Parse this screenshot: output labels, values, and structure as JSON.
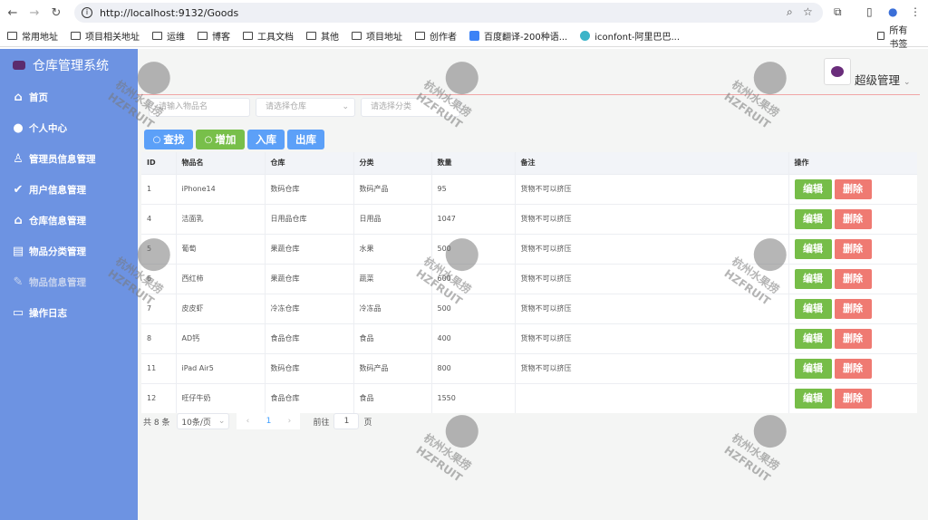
{
  "browser": {
    "url": "http://localhost:9132/Goods",
    "bookmarks": [
      "常用地址",
      "项目相关地址",
      "运维",
      "博客",
      "工具文档",
      "其他",
      "项目地址",
      "创作者",
      "百度翻译-200种语...",
      "iconfont-阿里巴巴..."
    ],
    "all_bookmarks": "所有书签"
  },
  "sidebar": {
    "title": "仓库管理系统",
    "items": [
      {
        "label": "首页",
        "icon": "home-icon"
      },
      {
        "label": "个人中心",
        "icon": "user-icon"
      },
      {
        "label": "管理员信息管理",
        "icon": "user-outline-icon"
      },
      {
        "label": "用户信息管理",
        "icon": "check-circle-icon"
      },
      {
        "label": "仓库信息管理",
        "icon": "house-icon"
      },
      {
        "label": "物品分类管理",
        "icon": "document-icon"
      },
      {
        "label": "物品信息管理",
        "icon": "edit-icon",
        "active": true
      },
      {
        "label": "操作日志",
        "icon": "notebook-icon"
      }
    ]
  },
  "header": {
    "user": "超级管理"
  },
  "filters": {
    "name_placeholder": "请输入物品名",
    "storage_placeholder": "请选择仓库",
    "type_placeholder": "请选择分类"
  },
  "buttons": {
    "search": "查找",
    "add": "增加",
    "in": "入库",
    "out": "出库"
  },
  "table": {
    "columns": [
      "ID",
      "物品名",
      "仓库",
      "分类",
      "数量",
      "备注",
      "操作"
    ],
    "rows": [
      [
        "1",
        "iPhone14",
        "数码仓库",
        "数码产品",
        "95",
        "货物不可以挤压"
      ],
      [
        "4",
        "洁面乳",
        "日用品仓库",
        "日用品",
        "1047",
        "货物不可以挤压"
      ],
      [
        "5",
        "葡萄",
        "果蔬仓库",
        "水果",
        "500",
        "货物不可以挤压"
      ],
      [
        "6",
        "西红柿",
        "果蔬仓库",
        "蔬菜",
        "600",
        "货物不可以挤压"
      ],
      [
        "7",
        "皮皮虾",
        "冷冻仓库",
        "冷冻品",
        "500",
        "货物不可以挤压"
      ],
      [
        "8",
        "AD钙",
        "食品仓库",
        "食品",
        "400",
        "货物不可以挤压"
      ],
      [
        "11",
        "iPad Air5",
        "数码仓库",
        "数码产品",
        "800",
        "货物不可以挤压"
      ],
      [
        "12",
        "旺仔牛奶",
        "食品仓库",
        "食品",
        "1550",
        ""
      ]
    ],
    "edit": "编辑",
    "delete": "删除"
  },
  "pagination": {
    "total": "共 8 条",
    "page_size": "10条/页",
    "current": "1",
    "goto": "前往",
    "goto_value": "1",
    "page_unit": "页"
  },
  "watermark": "杭州水果捞 HZFRUIT"
}
